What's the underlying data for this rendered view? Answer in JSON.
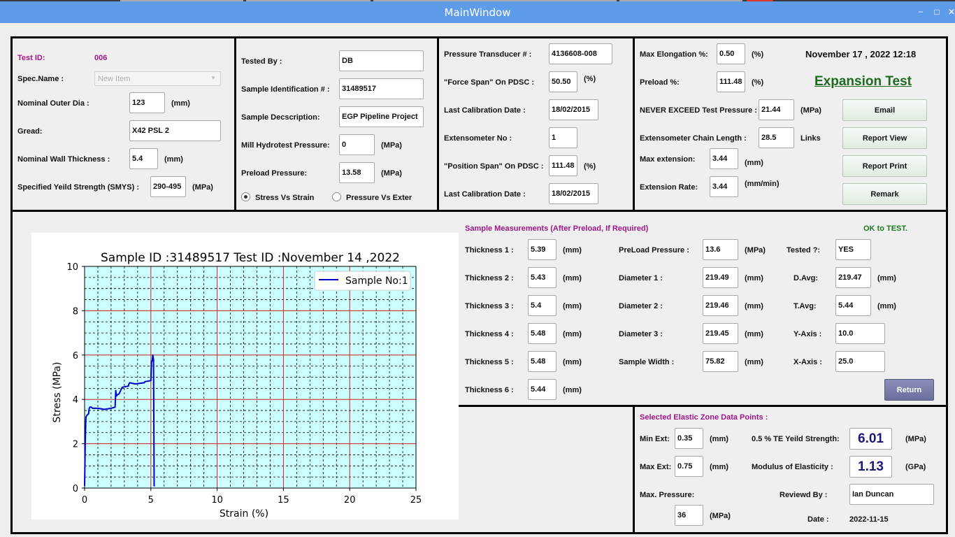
{
  "window": {
    "title": "MainWindow",
    "minimize": "−",
    "maximize": "□",
    "close": "✕"
  },
  "panel1": {
    "test_id_label": "Test ID:",
    "test_id_value": "006",
    "spec_name_label": "Spec.Name :",
    "spec_name_value": "New Item",
    "outer_dia_label": "Nominal Outer Dia :",
    "outer_dia_value": "123",
    "outer_dia_unit": "(mm)",
    "gread_label": "Gread:",
    "gread_value": "X42 PSL 2",
    "wall_label": "Nominal Wall Thickness :",
    "wall_value": "5.4",
    "wall_unit": "(mm)",
    "smys_label": "Specified Yeild Strength (SMYS) :",
    "smys_value": "290-495",
    "smys_unit": "(MPa)"
  },
  "panel2": {
    "tested_by_label": "Tested By :",
    "tested_by_value": "DB",
    "sample_id_label": "Sample Identification # :",
    "sample_id_value": "31489517",
    "desc_label": "Sample Decscription:",
    "desc_value": "EGP Pipeline Project",
    "mill_label": "Mill Hydrotest Pressure:",
    "mill_value": "0",
    "mill_unit": "(MPa)",
    "preload_label": "Preload Pressure:",
    "preload_value": "13.58",
    "preload_unit": "(MPa)",
    "radio_stress": "Stress Vs Strain",
    "radio_pressure": "Pressure Vs Exter"
  },
  "panel3": {
    "transducer_label": "Pressure Transducer # :",
    "transducer_value": "4136608-008",
    "force_span_label": "\"Force Span\" On PDSC :",
    "force_span_value": "50.50",
    "force_span_unit": "(%)",
    "cal_date1_label": "Last Calibration Date :",
    "cal_date1_value": "18/02/2015",
    "extensometer_label": "Extensometer No :",
    "extensometer_value": "1",
    "position_span_label": "\"Position Span\" On PDSC :",
    "position_span_value": "111.48",
    "position_span_unit": "(%)",
    "cal_date2_label": "Last Calibration Date :",
    "cal_date2_value": "18/02/2015"
  },
  "panel4": {
    "max_elong_label": "Max Elongation %:",
    "max_elong_value": "0.50",
    "max_elong_unit": "(%)",
    "datetime": "November  17 , 2022 12:18",
    "preload_pct_label": "Preload  %:",
    "preload_pct_value": "111.48",
    "preload_pct_unit": "(%)",
    "test_type": "Expansion Test",
    "never_exceed_label": "NEVER EXCEED Test Pressure :",
    "never_exceed_value": "21.44",
    "never_exceed_unit": "(MPa)",
    "chain_label": "Extensometer Chain Length :",
    "chain_value": "28.5",
    "chain_unit": "Links",
    "max_ext_label": "Max extension:",
    "max_ext_value": "3.44",
    "max_ext_unit": "(mm)",
    "ext_rate_label": "Extension Rate:",
    "ext_rate_value": "3.44",
    "ext_rate_unit": "(mm/min)",
    "btn_email": "Email",
    "btn_report_view": "Report View",
    "btn_report_print": "Report Print",
    "btn_remark": "Remark"
  },
  "measurements": {
    "heading": "Sample Measurements  (After Preload, If Required)",
    "status": "OK to TEST.",
    "mm": "(mm)",
    "mpa": "(MPa)",
    "thickness": [
      {
        "label": "Thickness 1 :",
        "value": "5.39"
      },
      {
        "label": "Thickness 2 :",
        "value": "5.43"
      },
      {
        "label": "Thickness 3 :",
        "value": "5.4"
      },
      {
        "label": "Thickness 4 :",
        "value": "5.48"
      },
      {
        "label": "Thickness 5 :",
        "value": "5.48"
      },
      {
        "label": "Thickness 6 :",
        "value": "5.44"
      }
    ],
    "preload_label": "PreLoad Pressure :",
    "preload_value": "13.6",
    "d1_label": "Diameter 1 :",
    "d1_value": "219.49",
    "d2_label": "Diameter 2 :",
    "d2_value": "219.46",
    "d3_label": "Diameter 3 :",
    "d3_value": "219.45",
    "width_label": "Sample Width :",
    "width_value": "75.82",
    "tested_label": "Tested ?:",
    "tested_value": "YES",
    "davg_label": "D.Avg:",
    "davg_value": "219.47",
    "tavg_label": "T.Avg:",
    "tavg_value": "5.44",
    "yaxis_label": "Y-Axis :",
    "yaxis_value": "10.0",
    "xaxis_label": "X-Axis :",
    "xaxis_value": "25.0",
    "btn_return": "Return"
  },
  "elastic": {
    "heading": "Selected Elastic Zone Data Points :",
    "min_ext_label": "Min Ext:",
    "min_ext_value": "0.35",
    "min_ext_unit": "(mm)",
    "max_ext_label": "Max Ext:",
    "max_ext_value": "0.75",
    "max_ext_unit": "(mm)",
    "max_pressure_label": "Max. Pressure:",
    "max_pressure_value": "36",
    "max_pressure_unit": "(MPa)",
    "yield_label": "0.5 % TE Yeild Strength:",
    "yield_value": "6.01",
    "yield_unit": "(MPa)",
    "modulus_label": "Modulus of Elasticity :",
    "modulus_value": "1.13",
    "modulus_unit": "(GPa)",
    "reviewed_label": "Reviewd  By :",
    "reviewed_value": "Ian Duncan",
    "date_label": "Date :",
    "date_value": "2022-11-15"
  },
  "chart_data": {
    "type": "line",
    "title": "Sample ID :31489517 Test ID :November  14 ,2022",
    "xlabel": "Strain (%)",
    "ylabel": "Stress (MPa)",
    "xlim": [
      0,
      25
    ],
    "ylim": [
      0,
      10
    ],
    "xticks": [
      "0",
      "5",
      "10",
      "15",
      "20",
      "25"
    ],
    "yticks": [
      "0",
      "2",
      "4",
      "6",
      "8",
      "10"
    ],
    "grid": true,
    "legend": "top-right",
    "colors": {
      "background": "#ccffff",
      "grid_major": "#d02020",
      "grid_minor": "#000000",
      "line": "#0000cc"
    },
    "series": [
      {
        "name": "Sample No:1",
        "x": [
          0,
          0.05,
          0.1,
          0.15,
          0.2,
          0.3,
          0.35,
          0.4,
          0.5,
          0.6,
          1.0,
          1.5,
          2.0,
          2.3,
          2.35,
          2.4,
          2.45,
          2.6,
          2.8,
          2.85,
          3.3,
          3.35,
          3.4,
          3.8,
          3.85,
          4.5,
          4.55,
          5.0,
          5.05,
          5.1,
          5.15,
          5.2,
          5.25,
          5.3
        ],
        "y": [
          0.1,
          2.0,
          3.2,
          3.25,
          3.3,
          3.35,
          3.6,
          3.65,
          3.65,
          3.6,
          3.6,
          3.55,
          3.6,
          3.65,
          4.4,
          4.15,
          4.2,
          4.25,
          4.5,
          4.55,
          4.6,
          4.7,
          4.75,
          4.7,
          4.7,
          4.75,
          4.8,
          4.85,
          5.7,
          5.75,
          6.0,
          5.8,
          0.1,
          0.1
        ]
      }
    ]
  }
}
